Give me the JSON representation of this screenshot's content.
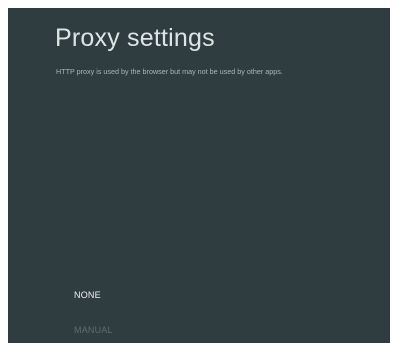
{
  "header": {
    "title": "Proxy settings",
    "description": "HTTP proxy is used by the browser but may not be used by other apps."
  },
  "proxy_options": {
    "items": [
      {
        "label": "NONE",
        "state": "focused"
      },
      {
        "label": "MANUAL",
        "state": "unfocused"
      }
    ]
  },
  "colors": {
    "background": "#2f3d40",
    "title": "#dde4e4",
    "focused_option": "#eef2f2",
    "unfocused_option": "#5e6c6e"
  }
}
